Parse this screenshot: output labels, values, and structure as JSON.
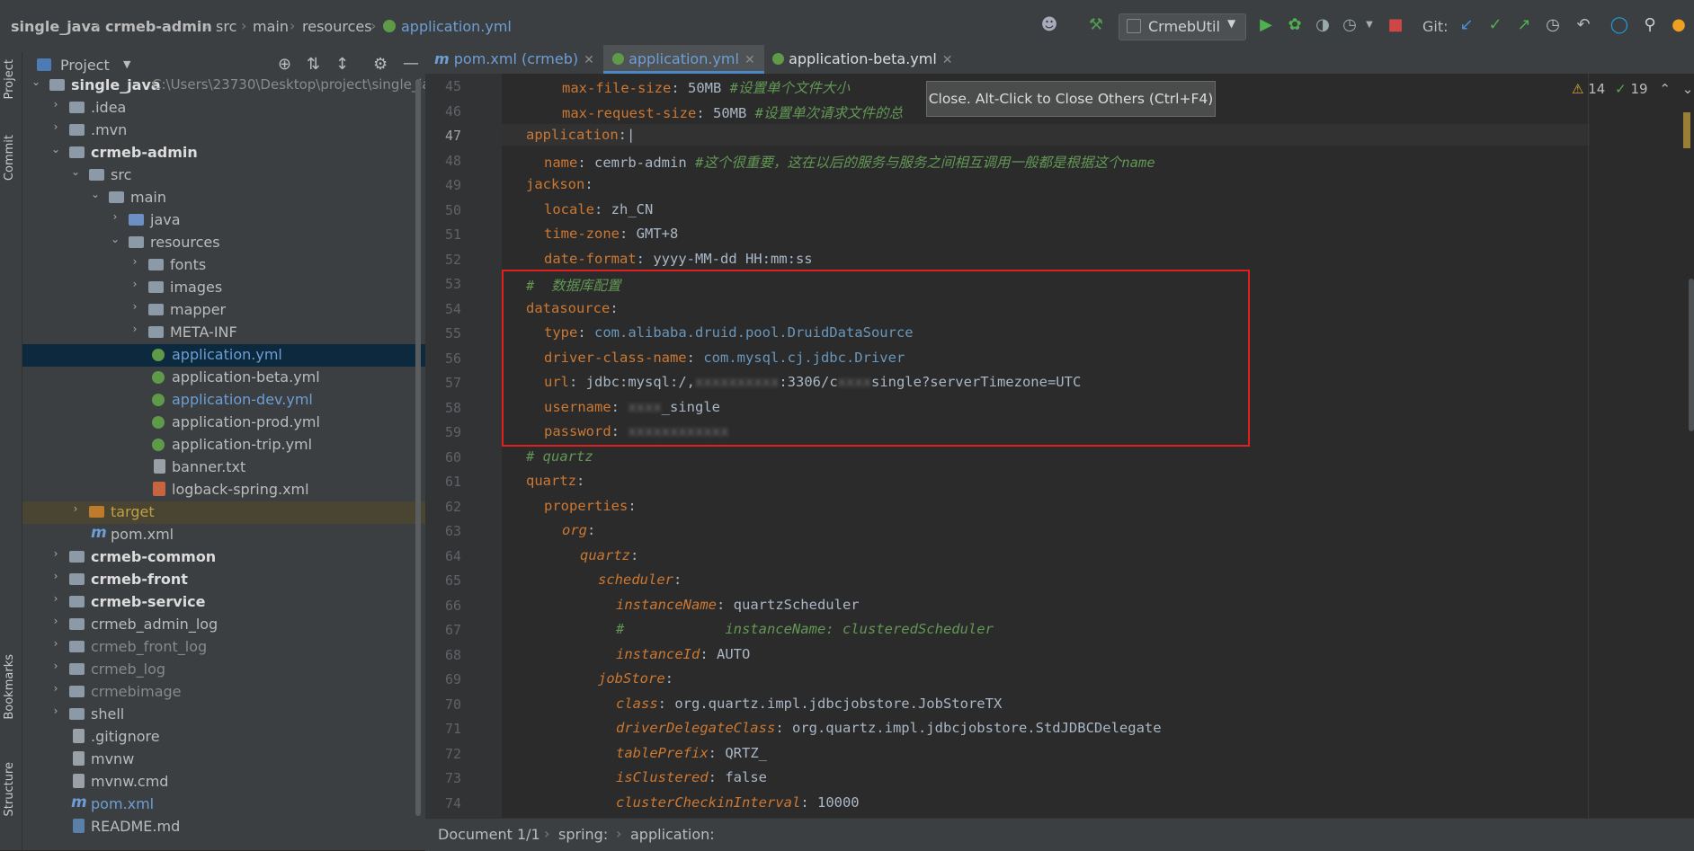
{
  "breadcrumbs": [
    "single_java",
    "crmeb-admin",
    "src",
    "main",
    "resources",
    "application.yml"
  ],
  "run_config": "CrmebUtil",
  "git_label": "Git:",
  "left_strip": {
    "project": "Project",
    "commit": "Commit",
    "bookmarks": "Bookmarks",
    "structure": "Structure"
  },
  "project_panel": {
    "title": "Project"
  },
  "tree": [
    {
      "label": "single_java",
      "extra": "C:\\Users\\23730\\Desktop\\project\\single_ja",
      "bold": true
    },
    {
      "label": ".idea"
    },
    {
      "label": ".mvn"
    },
    {
      "label": "crmeb-admin",
      "bold": true
    },
    {
      "label": "src"
    },
    {
      "label": "main"
    },
    {
      "label": "java"
    },
    {
      "label": "resources"
    },
    {
      "label": "fonts"
    },
    {
      "label": "images"
    },
    {
      "label": "mapper"
    },
    {
      "label": "META-INF"
    },
    {
      "label": "application.yml"
    },
    {
      "label": "application-beta.yml"
    },
    {
      "label": "application-dev.yml"
    },
    {
      "label": "application-prod.yml"
    },
    {
      "label": "application-trip.yml"
    },
    {
      "label": "banner.txt"
    },
    {
      "label": "logback-spring.xml"
    },
    {
      "label": "target"
    },
    {
      "label": "pom.xml"
    },
    {
      "label": "crmeb-common",
      "bold": true
    },
    {
      "label": "crmeb-front",
      "bold": true
    },
    {
      "label": "crmeb-service",
      "bold": true
    },
    {
      "label": "crmeb_admin_log"
    },
    {
      "label": "crmeb_front_log"
    },
    {
      "label": "crmeb_log"
    },
    {
      "label": "crmebimage"
    },
    {
      "label": "shell"
    },
    {
      "label": ".gitignore"
    },
    {
      "label": "mvnw"
    },
    {
      "label": "mvnw.cmd"
    },
    {
      "label": "pom.xml"
    },
    {
      "label": "README.md"
    }
  ],
  "tabs": [
    {
      "label": "pom.xml (crmeb)"
    },
    {
      "label": "application.yml"
    },
    {
      "label": "application-beta.yml"
    }
  ],
  "tooltip": "Close. Alt-Click to Close Others (Ctrl+F4)",
  "inspections": {
    "warnings": "14",
    "ok": "19"
  },
  "line_numbers": [
    "45",
    "46",
    "47",
    "48",
    "49",
    "50",
    "51",
    "52",
    "53",
    "54",
    "55",
    "56",
    "57",
    "58",
    "59",
    "60",
    "61",
    "62",
    "63",
    "64",
    "65",
    "66",
    "67",
    "68",
    "69",
    "70",
    "71",
    "72",
    "73",
    "74"
  ],
  "code": {
    "l45": {
      "key": "max-file-size",
      "val": "50MB",
      "comment": "#设置单个文件大小"
    },
    "l46": {
      "key": "max-request-size",
      "val": "50MB",
      "comment": "#设置单次请求文件的总"
    },
    "l47": {
      "key": "application"
    },
    "l48": {
      "key": "name",
      "val": "cemrb-admin",
      "comment": "#这个很重要，这在以后的服务与服务之间相互调用一般都是根据这个name"
    },
    "l49": {
      "key": "jackson"
    },
    "l50": {
      "key": "locale",
      "val": "zh_CN"
    },
    "l51": {
      "key": "time-zone",
      "val": "GMT+8"
    },
    "l52": {
      "key": "date-format",
      "val": "yyyy-MM-dd HH:mm:ss"
    },
    "l53": {
      "comment": "#  数据库配置"
    },
    "l54": {
      "key": "datasource"
    },
    "l55": {
      "key": "type",
      "val": "com.alibaba.druid.pool.DruidDataSource"
    },
    "l56": {
      "key": "driver-class-name",
      "val": "com.mysql.cj.jdbc.Driver"
    },
    "l57": {
      "key": "url",
      "val_a": "jdbc:mysql:/,",
      "val_blur": "xxxxxxxxxx",
      "val_b": ":3306/c",
      "val_blur2": "xxxx",
      "val_c": "single?serverTimezone=UTC"
    },
    "l58": {
      "key": "username",
      "val_blur": "xxxx",
      "val": "_single"
    },
    "l59": {
      "key": "password",
      "val_blur": "xxxxxxxxxxxx"
    },
    "l60": {
      "comment": "# quartz"
    },
    "l61": {
      "key": "quartz"
    },
    "l62": {
      "key": "properties"
    },
    "l63": {
      "key": "org"
    },
    "l64": {
      "key": "quartz"
    },
    "l65": {
      "key": "scheduler"
    },
    "l66": {
      "key": "instanceName",
      "val": "quartzScheduler"
    },
    "l67": {
      "comment": "#            instanceName: clusteredScheduler"
    },
    "l68": {
      "key": "instanceId",
      "val": "AUTO"
    },
    "l69": {
      "key": "jobStore"
    },
    "l70": {
      "key": "class",
      "val": "org.quartz.impl.jdbcjobstore.JobStoreTX"
    },
    "l71": {
      "key": "driverDelegateClass",
      "val": "org.quartz.impl.jdbcjobstore.StdJDBCDelegate"
    },
    "l72": {
      "key": "tablePrefix",
      "val": "QRTZ_"
    },
    "l73": {
      "key": "isClustered",
      "val": "false"
    },
    "l74": {
      "key": "clusterCheckinInterval",
      "val": "10000"
    }
  },
  "status": {
    "document": "Document 1/1",
    "path1": "spring:",
    "path2": "application:"
  },
  "colors": {
    "highlight_box": "#e02020",
    "selected_row": "#0d293e",
    "accent": "#cc7832"
  }
}
